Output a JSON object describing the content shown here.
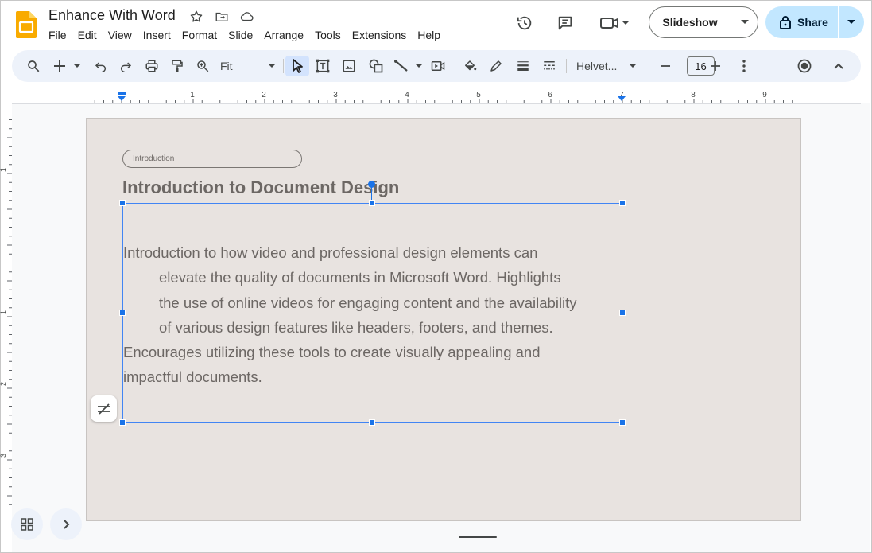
{
  "document": {
    "title": "Enhance With Word"
  },
  "menu": [
    "File",
    "Edit",
    "View",
    "Insert",
    "Format",
    "Slide",
    "Arrange",
    "Tools",
    "Extensions",
    "Help"
  ],
  "header": {
    "slideshow_label": "Slideshow",
    "share_label": "Share"
  },
  "toolbar": {
    "zoom_value": "Fit",
    "font_name": "Helvet...",
    "font_size": "16"
  },
  "ruler": {
    "ticks": [
      "1",
      "2",
      "3",
      "4",
      "5",
      "6",
      "7",
      "8",
      "9"
    ],
    "vticks": [
      "1",
      "1",
      "2",
      "3"
    ]
  },
  "slide": {
    "tag": "Introduction",
    "title": "Introduction to Document Design",
    "body_lines": [
      "Introduction to how video and professional design elements can",
      "elevate the quality of documents in Microsoft Word. Highlights",
      "the use of online videos for engaging content and the availability",
      "of various design features like headers, footers, and themes.",
      "Encourages utilizing these tools to create visually appealing and",
      "impactful documents."
    ]
  },
  "colors": {
    "accent": "#1a73e8",
    "share_bg": "#c2e7ff",
    "slide_bg": "#e8e3e0",
    "toolbar_bg": "#edf2fa"
  }
}
